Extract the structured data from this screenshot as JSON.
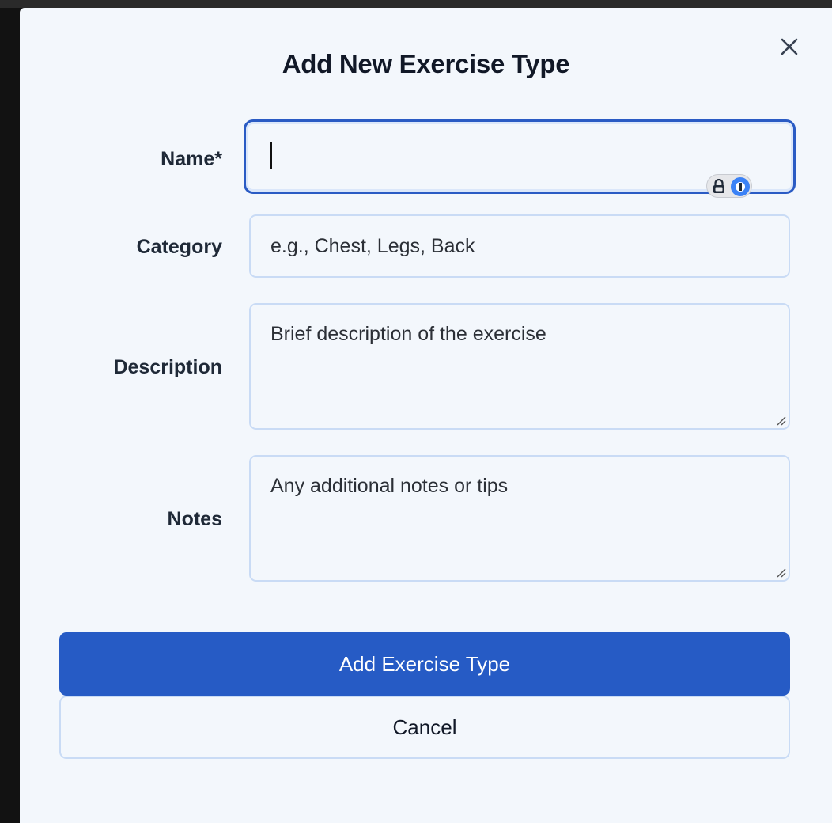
{
  "modal": {
    "title": "Add New Exercise Type",
    "close_icon": "close-icon"
  },
  "form": {
    "name": {
      "label": "Name*",
      "value": "",
      "placeholder": "",
      "password_manager_icon": "1password-lock-icon"
    },
    "category": {
      "label": "Category",
      "value": "",
      "placeholder": "e.g., Chest, Legs, Back"
    },
    "description": {
      "label": "Description",
      "value": "",
      "placeholder": "Brief description of the exercise"
    },
    "notes": {
      "label": "Notes",
      "value": "",
      "placeholder": "Any additional notes or tips"
    }
  },
  "actions": {
    "submit_label": "Add Exercise Type",
    "cancel_label": "Cancel"
  },
  "colors": {
    "primary": "#265bc5",
    "modal_background": "#f3f7fc",
    "input_border": "#c9dbf5",
    "focus_border": "#2a5bc4"
  }
}
